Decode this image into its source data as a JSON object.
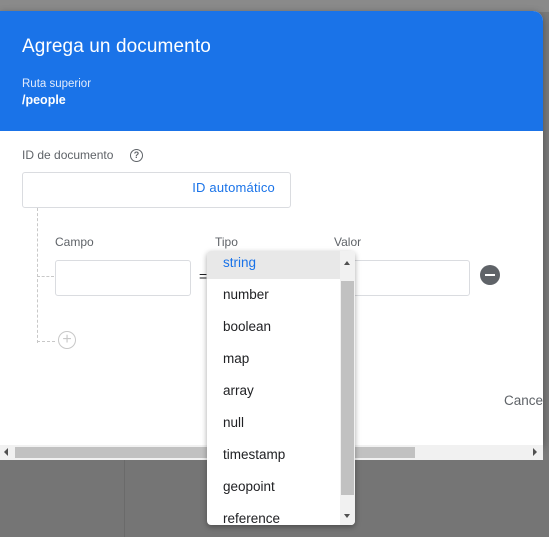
{
  "dialog": {
    "title": "Agrega un documento",
    "parent_path_label": "Ruta superior",
    "parent_path": "/people",
    "document_id_label": "ID de documento",
    "auto_id_label": "ID automático",
    "cancel_label": "Cancel"
  },
  "field_row": {
    "field_label": "Campo",
    "type_label": "Tipo",
    "value_label": "Valor",
    "field_value": "",
    "value_value": "",
    "equals": "="
  },
  "type_dropdown": {
    "selected": "string",
    "options": [
      "string",
      "number",
      "boolean",
      "map",
      "array",
      "null",
      "timestamp",
      "geopoint",
      "reference"
    ]
  },
  "colors": {
    "header": "#1a73e8",
    "accent": "#1a73e8"
  },
  "icons": [
    "help-icon",
    "remove-field-icon",
    "add-field-icon"
  ]
}
